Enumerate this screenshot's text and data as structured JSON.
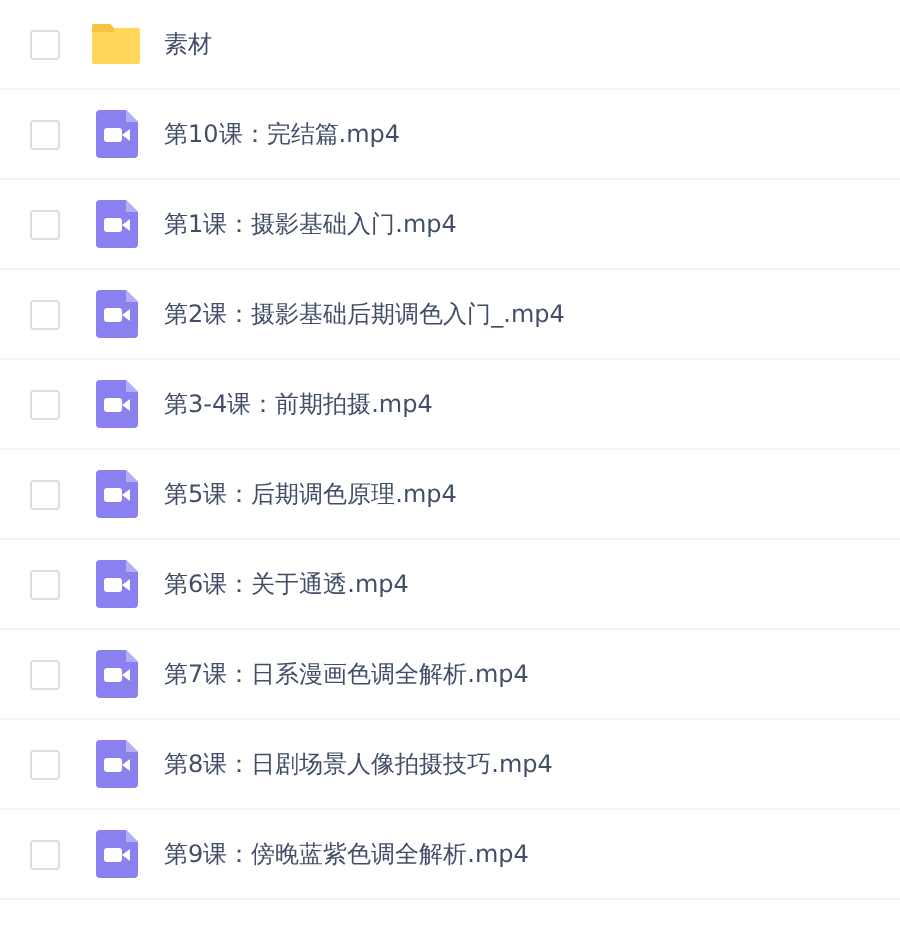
{
  "files": [
    {
      "kind": "folder",
      "name": "素材",
      "checked": false
    },
    {
      "kind": "video",
      "name": "第10课：完结篇.mp4",
      "checked": false
    },
    {
      "kind": "video",
      "name": "第1课：摄影基础入门.mp4",
      "checked": false
    },
    {
      "kind": "video",
      "name": "第2课：摄影基础后期调色入门_.mp4",
      "checked": false
    },
    {
      "kind": "video",
      "name": "第3-4课：前期拍摄.mp4",
      "checked": false
    },
    {
      "kind": "video",
      "name": "第5课：后期调色原理.mp4",
      "checked": false
    },
    {
      "kind": "video",
      "name": "第6课：关于通透.mp4",
      "checked": false
    },
    {
      "kind": "video",
      "name": "第7课：日系漫画色调全解析.mp4",
      "checked": false
    },
    {
      "kind": "video",
      "name": "第8课：日剧场景人像拍摄技巧.mp4",
      "checked": false
    },
    {
      "kind": "video",
      "name": "第9课：傍晚蓝紫色调全解析.mp4",
      "checked": false
    }
  ]
}
